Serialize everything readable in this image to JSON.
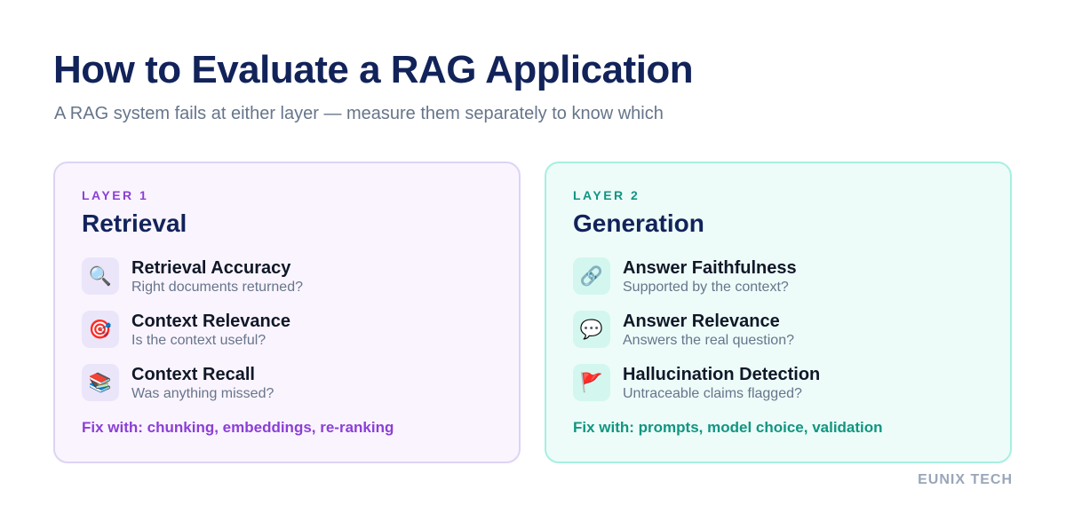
{
  "header": {
    "title": "How to Evaluate a RAG Application",
    "subtitle": "A RAG system fails at either layer — measure them separately to know which"
  },
  "layers": [
    {
      "label": "LAYER 1",
      "title": "Retrieval",
      "accent_color": "#8b3fd6",
      "items": [
        {
          "icon": "magnifying-glass-icon",
          "glyph": "🔍",
          "name": "Retrieval Accuracy",
          "desc": "Right documents returned?"
        },
        {
          "icon": "target-icon",
          "glyph": "🎯",
          "name": "Context Relevance",
          "desc": "Is the context useful?"
        },
        {
          "icon": "books-icon",
          "glyph": "📚",
          "name": "Context Recall",
          "desc": "Was anything missed?"
        }
      ],
      "fix": "Fix with: chunking, embeddings, re-ranking"
    },
    {
      "label": "LAYER 2",
      "title": "Generation",
      "accent_color": "#119580",
      "items": [
        {
          "icon": "link-icon",
          "glyph": "🔗",
          "name": "Answer Faithfulness",
          "desc": "Supported by the context?"
        },
        {
          "icon": "speech-bubble-icon",
          "glyph": "💬",
          "name": "Answer Relevance",
          "desc": "Answers the real question?"
        },
        {
          "icon": "red-flag-icon",
          "glyph": "🚩",
          "name": "Hallucination Detection",
          "desc": "Untraceable claims flagged?"
        }
      ],
      "fix": "Fix with: prompts, model choice, validation"
    }
  ],
  "footer": {
    "brand": "EUNIX TECH"
  }
}
